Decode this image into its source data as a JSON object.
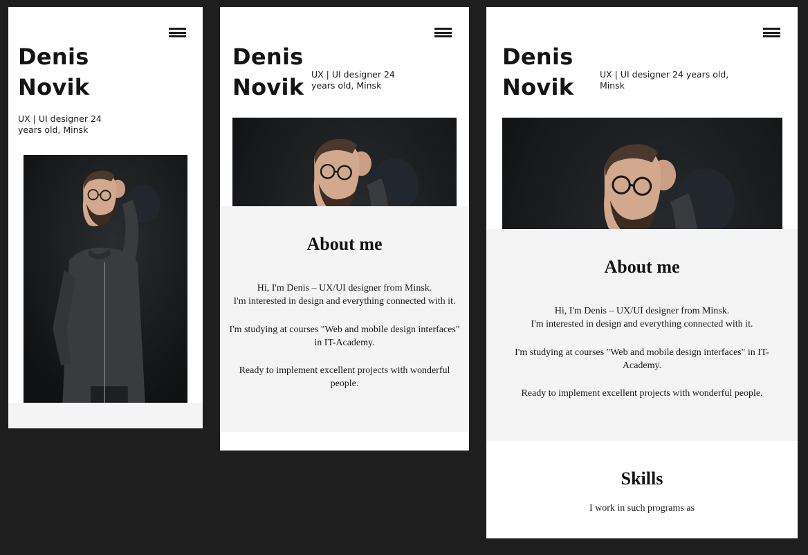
{
  "profile": {
    "first_name": "Denis",
    "last_name": "Novik"
  },
  "tagline": {
    "narrow": [
      "UX | UI designer 24",
      "years old, Minsk"
    ],
    "medium": [
      "UX | UI designer 24",
      "years old, Minsk"
    ],
    "wide": [
      "UX | UI designer 24 years old,",
      "Minsk"
    ]
  },
  "about": {
    "title": "About me",
    "medium": {
      "p1": [
        "Hi, I'm Denis – UX/UI designer from Minsk.",
        "I'm interested in design and everything connected with it."
      ],
      "p2": [
        "I'm studying at courses \"Web and mobile design interfaces\"",
        "in IT-Academy."
      ],
      "p3": [
        "Ready to implement excellent projects with wonderful",
        "people."
      ]
    },
    "wide": {
      "p1": [
        "Hi, I'm Denis – UX/UI designer from Minsk.",
        "I'm interested in design and everything connected with it."
      ],
      "p2": [
        "I'm studying at courses \"Web and mobile design interfaces\" in IT-",
        "Academy."
      ],
      "p3": [
        "Ready to implement excellent projects with wonderful people."
      ]
    }
  },
  "skills": {
    "title": "Skills",
    "intro": "I work in such programs as"
  },
  "icons": {
    "menu": "hamburger-menu-icon"
  },
  "colors": {
    "canvas": "#1e1e1e",
    "panel": "#ffffff",
    "section_gray": "#f4f4f4",
    "photo_background": "#151618",
    "text": "#141414"
  }
}
